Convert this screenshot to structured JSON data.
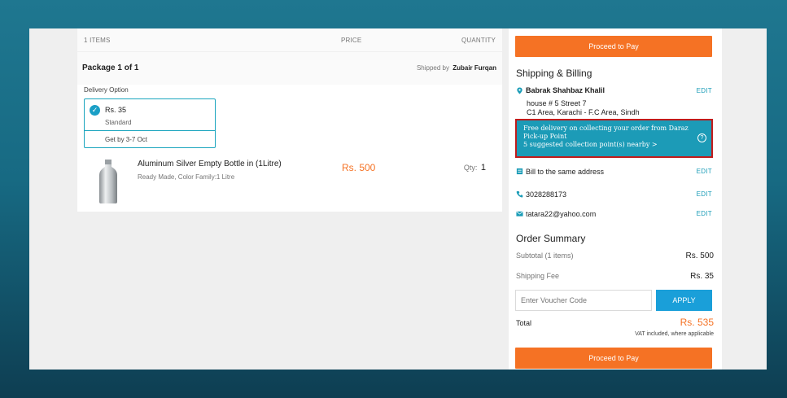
{
  "cart": {
    "items_header": "1 ITEMS",
    "price_header": "PRICE",
    "quantity_header": "QUANTITY",
    "package_title": "Package 1 of 1",
    "shipped_by_label": "Shipped by",
    "shipped_by_name": "Zubair Furqan",
    "delivery_option_label": "Delivery Option",
    "delivery_price": "Rs. 35",
    "delivery_type": "Standard",
    "delivery_eta": "Get by 3-7 Oct",
    "product_name": "Aluminum Silver Empty Bottle in (1Litre)",
    "product_variant": "Ready Made, Color Family:1 Litre",
    "product_price": "Rs. 500",
    "qty_label": "Qty:",
    "qty_value": "1"
  },
  "checkout": {
    "proceed_label": "Proceed to Pay",
    "shipping_title": "Shipping & Billing",
    "customer_name": "Babrak Shahbaz Khalil",
    "edit_label": "EDIT",
    "address_line1": "house # 5 Street 7",
    "address_line2": "C1 Area, Karachi - F.C Area, Sindh",
    "pickup_line1": "Free delivery on collecting your order from Daraz",
    "pickup_line2": "Pick-up Point",
    "pickup_line3": "5 suggested collection point(s) nearby >",
    "bill_same": "Bill to the same address",
    "phone": "3028288173",
    "email": "tatara22@yahoo.com",
    "summary_title": "Order Summary",
    "subtotal_label": "Subtotal (1 items)",
    "subtotal_value": "Rs. 500",
    "shipping_fee_label": "Shipping Fee",
    "shipping_fee_value": "Rs. 35",
    "voucher_placeholder": "Enter Voucher Code",
    "apply_label": "APPLY",
    "total_label": "Total",
    "total_value": "Rs. 535",
    "vat_note": "VAT included, where applicable"
  },
  "colors": {
    "accent_orange": "#f57224",
    "link_teal": "#1a9cb7",
    "apply_blue": "#1a9fd9",
    "pickup_bg": "#1c9bb7",
    "highlight_red": "#c21b1b"
  },
  "icons": {
    "check": "check-icon",
    "location": "location-pin-icon",
    "help": "question-icon",
    "bill": "bill-icon",
    "phone": "phone-icon",
    "email": "email-icon"
  }
}
